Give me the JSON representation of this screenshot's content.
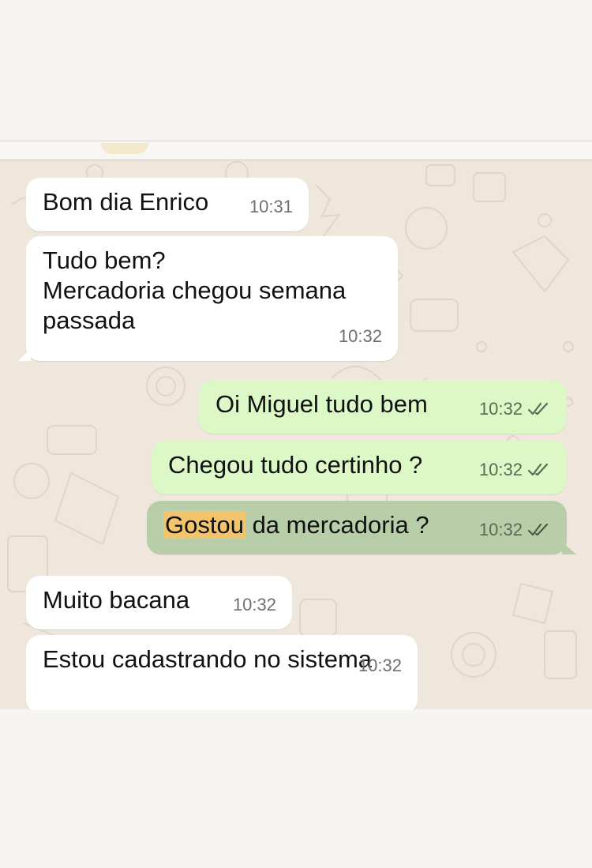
{
  "messages": [
    {
      "id": "m1",
      "direction": "incoming",
      "text": "Bom dia Enrico",
      "time": "10:31"
    },
    {
      "id": "m2",
      "direction": "incoming",
      "text": "Tudo bem?\nMercadoria chegou semana\npassada",
      "time": "10:32"
    },
    {
      "id": "m3",
      "direction": "outgoing",
      "text": "Oi Miguel tudo bem",
      "time": "10:32",
      "status": "read"
    },
    {
      "id": "m4",
      "direction": "outgoing",
      "text": "Chegou tudo certinho ?",
      "time": "10:32",
      "status": "read"
    },
    {
      "id": "m5",
      "direction": "outgoing",
      "text_highlight": "Gostou",
      "text_rest": " da mercadoria ?",
      "time": "10:32",
      "status": "read",
      "selected": true
    },
    {
      "id": "m6",
      "direction": "incoming",
      "text": "Muito bacana",
      "time": "10:32"
    },
    {
      "id": "m7",
      "direction": "incoming",
      "text": "Estou cadastrando no sistema",
      "time": "10:32"
    }
  ],
  "colors": {
    "incoming_bubble": "#ffffff",
    "outgoing_bubble": "#dcf8c6",
    "selected_bubble": "#b7cea8",
    "highlight": "#f2c46c",
    "wallpaper": "#efe7dc"
  },
  "icons": {
    "read_receipt": "double-check-icon"
  }
}
